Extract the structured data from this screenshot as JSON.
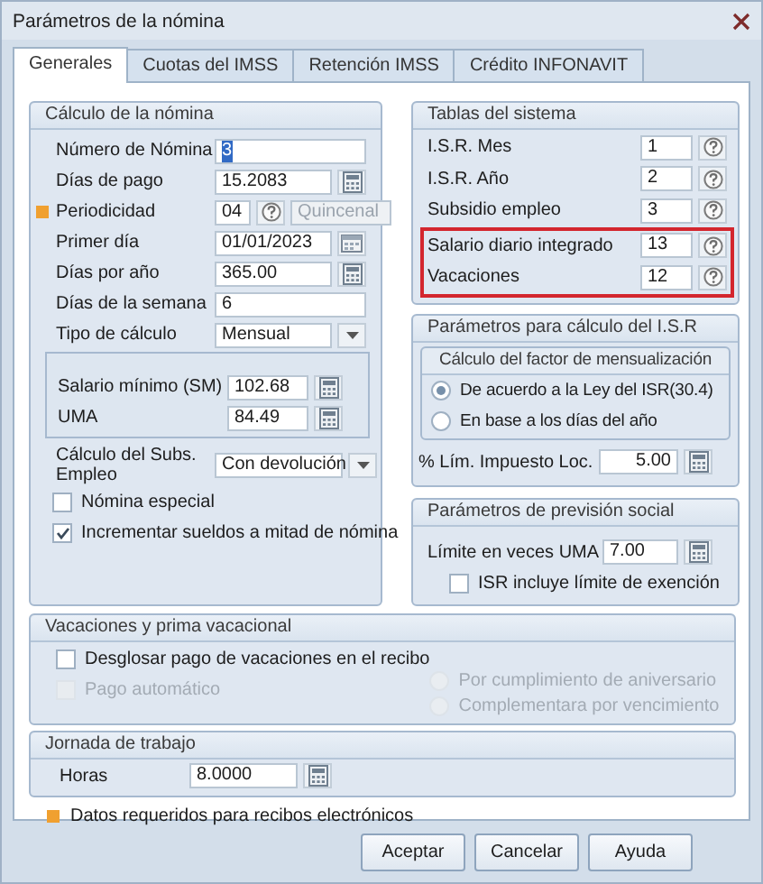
{
  "window": {
    "title": "Parámetros de la nómina"
  },
  "tabs": [
    {
      "label": "Generales",
      "selected": true
    },
    {
      "label": "Cuotas del IMSS",
      "selected": false
    },
    {
      "label": "Retención IMSS",
      "selected": false
    },
    {
      "label": "Crédito INFONAVIT",
      "selected": false
    }
  ],
  "calculo": {
    "title": "Cálculo de la nómina",
    "fields": [
      {
        "kind": "text",
        "label": "Número de Nómina",
        "value": "3",
        "required": false,
        "focused": true
      },
      {
        "kind": "calc",
        "label": "Días de pago",
        "value": "15.2083",
        "required": false,
        "focused": false
      },
      {
        "kind": "code",
        "label": "Periodicidad",
        "value": "04",
        "description": "Quincenal",
        "required": true,
        "focused": false
      },
      {
        "kind": "date",
        "label": "Primer día",
        "value": "01/01/2023",
        "required": false,
        "focused": false
      },
      {
        "kind": "calc",
        "label": "Días por año",
        "value": "365.00",
        "required": false,
        "focused": false
      },
      {
        "kind": "text",
        "label": "Días de la semana",
        "value": "6",
        "required": false,
        "focused": false
      },
      {
        "kind": "select",
        "label": "Tipo de cálculo",
        "value": "Mensual",
        "required": false,
        "focused": false
      }
    ],
    "salario_box": [
      {
        "kind": "calc",
        "label": "Salario mínimo (SM)",
        "value": "102.68"
      },
      {
        "kind": "calc",
        "label": "UMA",
        "value": "84.49"
      }
    ],
    "subs": {
      "kind": "select",
      "label": "Cálculo del Subs. Empleo",
      "value": "Con devolución"
    },
    "checks": [
      {
        "label": "Nómina especial",
        "checked": false
      },
      {
        "label": "Incrementar sueldos a mitad de nómina",
        "checked": true
      }
    ]
  },
  "tablas": {
    "title": "Tablas del sistema",
    "rows": [
      {
        "label": "I.S.R. Mes",
        "value": "1",
        "highlighted": false
      },
      {
        "label": "I.S.R. Año",
        "value": "2",
        "highlighted": false
      },
      {
        "label": "Subsidio empleo",
        "value": "3",
        "highlighted": false
      },
      {
        "label": "Salario diario integrado",
        "value": "13",
        "highlighted": true
      },
      {
        "label": "Vacaciones",
        "value": "12",
        "highlighted": true
      }
    ]
  },
  "isr": {
    "title": "Parámetros para cálculo del I.S.R",
    "subgroup": {
      "title": "Cálculo del factor de mensualización",
      "options": [
        {
          "label": "De acuerdo a la Ley del ISR(30.4)",
          "selected": true
        },
        {
          "label": "En base a los días del año",
          "selected": false
        }
      ]
    },
    "limit": {
      "label": "% Lím. Impuesto Loc.",
      "value": "5.00"
    }
  },
  "prevision": {
    "title": "Parámetros de previsión social",
    "field": {
      "label": "Límite en veces UMA",
      "value": "7.00"
    },
    "check": {
      "label": "ISR incluye límite de exención",
      "checked": false
    }
  },
  "vacaciones": {
    "title": "Vacaciones y prima vacacional",
    "checks": [
      {
        "label": "Desglosar pago de vacaciones en el recibo",
        "checked": false,
        "disabled": false
      },
      {
        "label": "Pago automático",
        "checked": false,
        "disabled": true
      }
    ],
    "options": [
      {
        "label": "Por cumplimiento de aniversario",
        "selected": false,
        "disabled": true
      },
      {
        "label": "Complementara por vencimiento",
        "selected": false,
        "disabled": true
      }
    ]
  },
  "jornada": {
    "title": "Jornada de trabajo",
    "field": {
      "label": "Horas",
      "value": "8.0000"
    }
  },
  "legend": "Datos requeridos para recibos electrónicos",
  "buttons": [
    "Aceptar",
    "Cancelar",
    "Ayuda"
  ]
}
